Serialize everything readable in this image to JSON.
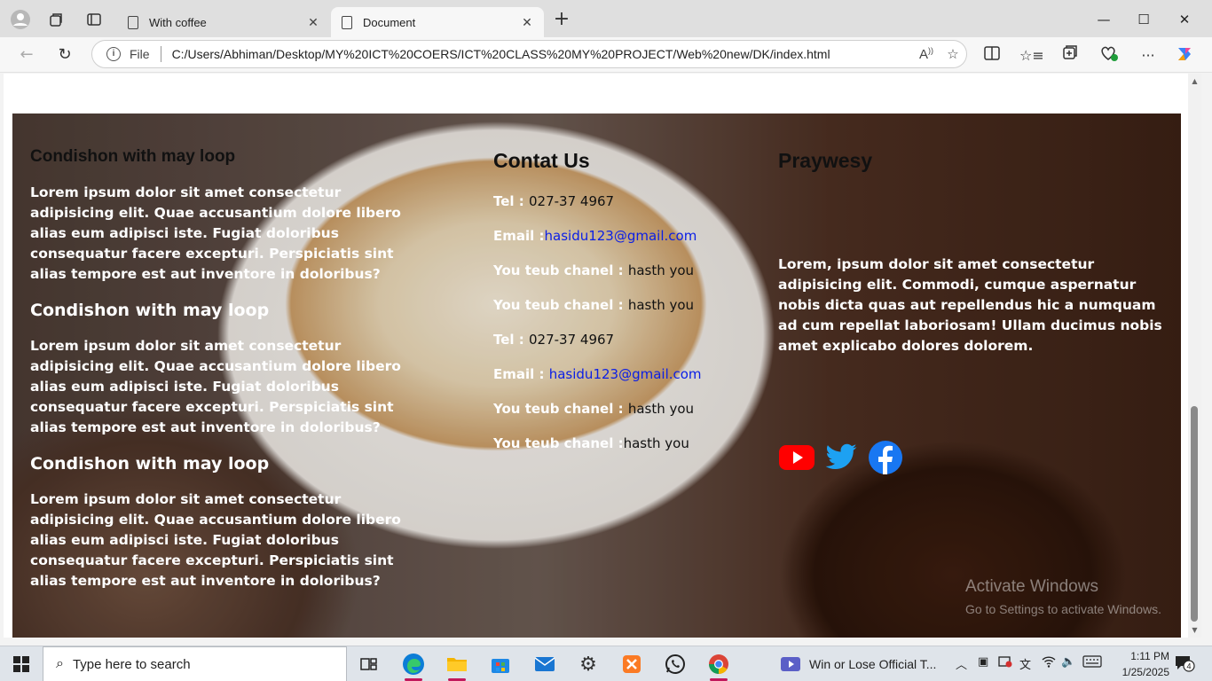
{
  "browser": {
    "tabs": [
      {
        "label": "With coffee",
        "active": false
      },
      {
        "label": "Document",
        "active": true
      }
    ],
    "address": {
      "scheme": "File",
      "url": "C:/Users/Abhiman/Desktop/MY%20ICT%20COERS/ICT%20CLASS%20MY%20PROJECT/Web%20new/DK/index.html"
    }
  },
  "page": {
    "column1": {
      "heading_top": "Condishon with may loop",
      "sections": [
        {
          "heading": "",
          "text": "Lorem ipsum dolor sit amet consectetur adipisicing elit. Quae accusantium dolore libero alias eum adipisci iste. Fugiat doloribus consequatur facere excepturi. Perspiciatis sint alias tempore est aut inventore in doloribus?"
        },
        {
          "heading": "Condishon with may loop",
          "text": "Lorem ipsum dolor sit amet consectetur adipisicing elit. Quae accusantium dolore libero alias eum adipisci iste. Fugiat doloribus consequatur facere excepturi. Perspiciatis sint alias tempore est aut inventore in doloribus?"
        },
        {
          "heading": "Condishon with may loop",
          "text": "Lorem ipsum dolor sit amet consectetur adipisicing elit. Quae accusantium dolore libero alias eum adipisci iste. Fugiat doloribus consequatur facere excepturi. Perspiciatis sint alias tempore est aut inventore in doloribus?"
        }
      ]
    },
    "column2": {
      "heading": "Contat Us",
      "rows": [
        {
          "label": "Tel : ",
          "value": "027-37 4967",
          "is_link": false
        },
        {
          "label": "Email :",
          "value": "hasidu123@gmail.com",
          "is_link": true
        },
        {
          "label": "You teub chanel : ",
          "value": "hasth you",
          "is_link": false
        },
        {
          "label": "You teub chanel : ",
          "value": "hasth you",
          "is_link": false
        },
        {
          "label": "Tel : ",
          "value": "027-37 4967",
          "is_link": false
        },
        {
          "label": "Email : ",
          "value": "hasidu123@gmail.com",
          "is_link": true
        },
        {
          "label": "You teub chanel : ",
          "value": "hasth you",
          "is_link": false
        },
        {
          "label": "You teub chanel :",
          "value": "hasth you",
          "is_link": false
        }
      ]
    },
    "column3": {
      "heading": "Praywesy",
      "text": "Lorem, ipsum dolor sit amet consectetur adipisicing elit. Commodi, cumque aspernatur nobis dicta quas aut repellendus hic a numquam ad cum repellat laboriosam! Ullam ducimus nobis amet explicabo dolores dolorem.",
      "socials": [
        "youtube-icon",
        "twitter-icon",
        "facebook-icon"
      ]
    },
    "watermark": {
      "line1": "Activate Windows",
      "line2": "Go to Settings to activate Windows."
    }
  },
  "taskbar": {
    "search_placeholder": "Type here to search",
    "media_title": "Win or Lose Official T...",
    "time": "1:11 PM",
    "date": "1/25/2025",
    "notifications": "4"
  },
  "colors": {
    "link": "#0a1ee6",
    "youtube": "#ff0000",
    "twitter": "#1da1f2",
    "facebook": "#1877f2"
  }
}
